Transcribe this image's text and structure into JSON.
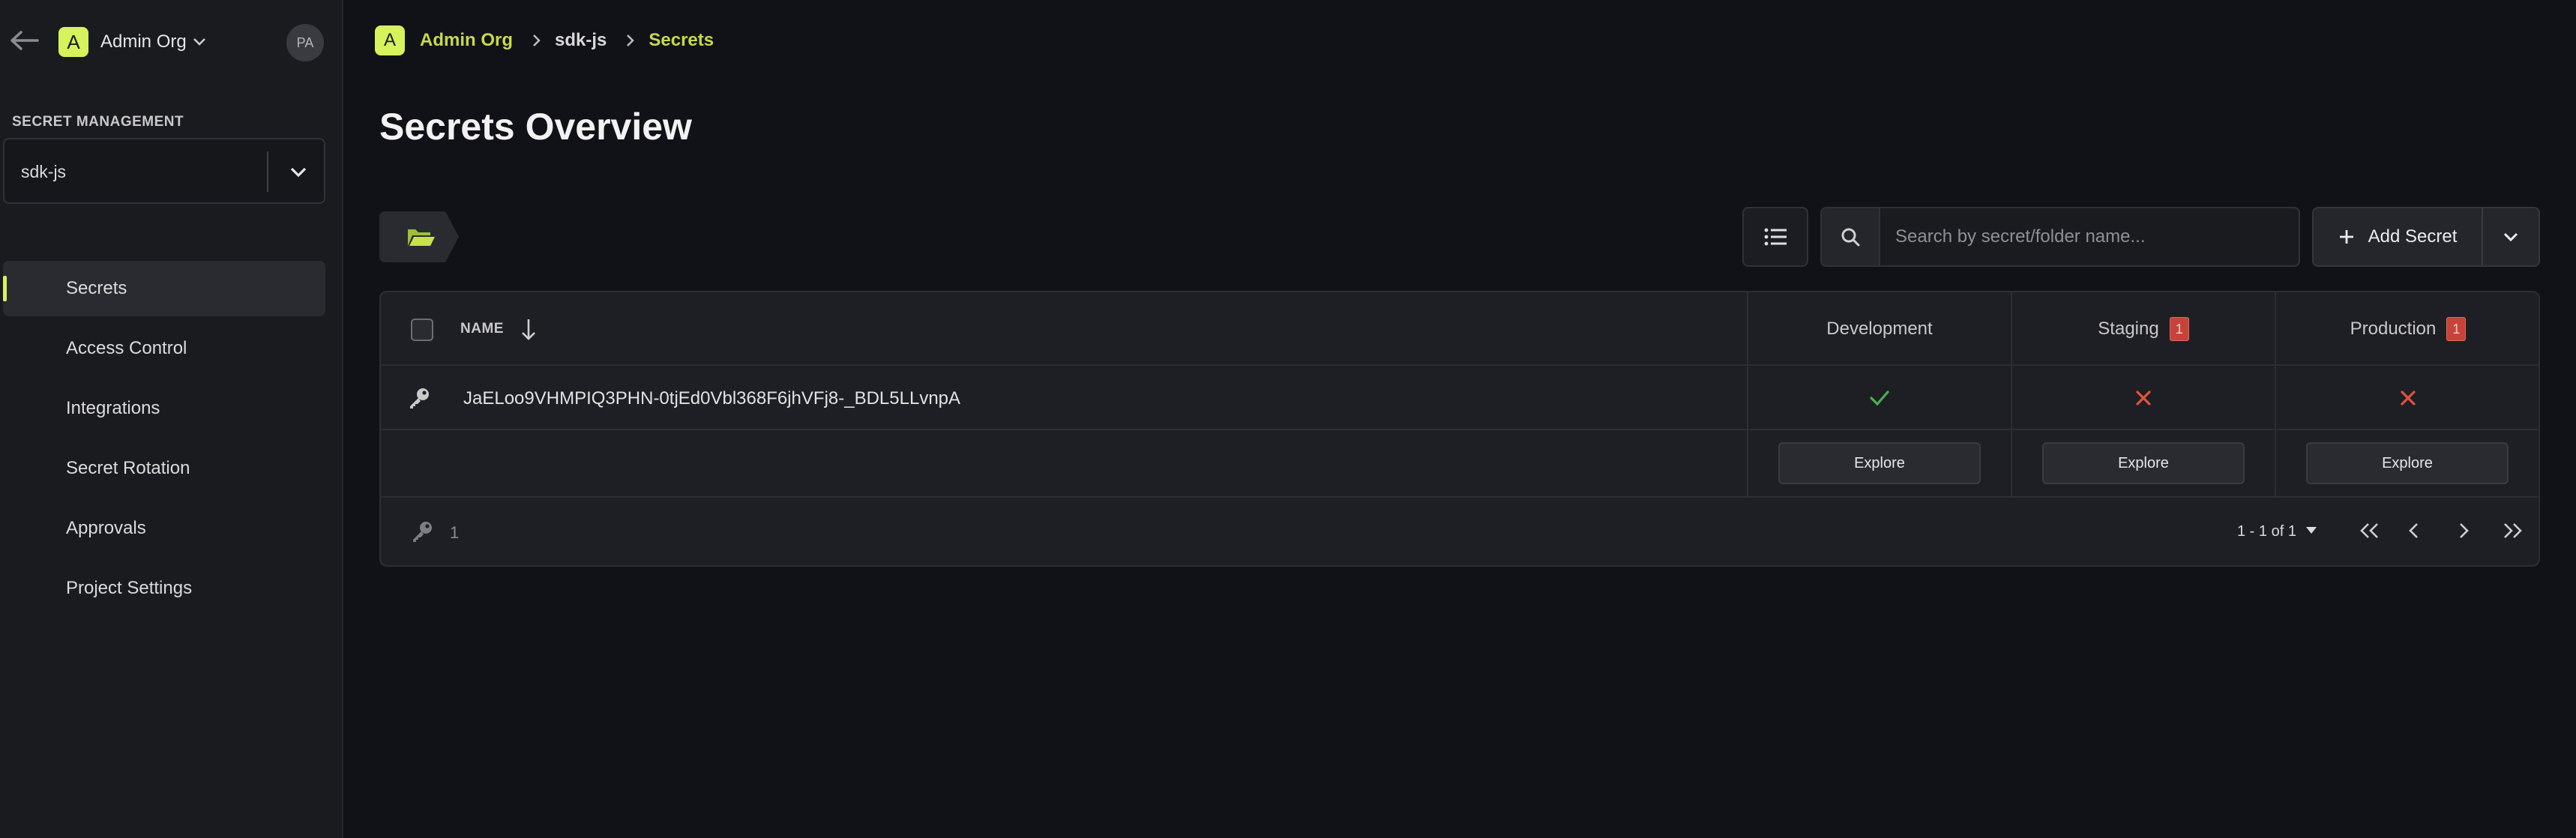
{
  "sidebar": {
    "org_badge": "A",
    "org_name": "Admin Org",
    "avatar_initials": "PA",
    "section_title": "SECRET MANAGEMENT",
    "project_select_value": "sdk-js",
    "nav": [
      {
        "label": "Secrets",
        "active": true
      },
      {
        "label": "Access Control",
        "active": false
      },
      {
        "label": "Integrations",
        "active": false
      },
      {
        "label": "Secret Rotation",
        "active": false
      },
      {
        "label": "Approvals",
        "active": false
      },
      {
        "label": "Project Settings",
        "active": false
      }
    ]
  },
  "breadcrumb": {
    "badge": "A",
    "org": "Admin Org",
    "project": "sdk-js",
    "current": "Secrets"
  },
  "page": {
    "title": "Secrets Overview"
  },
  "toolbar": {
    "search_placeholder": "Search by secret/folder name...",
    "add_secret_label": "Add Secret"
  },
  "table": {
    "name_header": "NAME",
    "environments": [
      {
        "name": "Development",
        "badge": ""
      },
      {
        "name": "Staging",
        "badge": "1"
      },
      {
        "name": "Production",
        "badge": "1"
      }
    ],
    "rows": [
      {
        "name": "JaELoo9VHMPIQ3PHN-0tjEd0Vbl368F6jhVFj8-_BDL5LLvnpA",
        "status": [
          "present",
          "missing",
          "missing"
        ]
      }
    ],
    "explore_label": "Explore",
    "footer_count": "1",
    "pagination_range": "1 - 1 of 1"
  },
  "colors": {
    "accent": "#d6f25c",
    "success": "#4caf50",
    "danger": "#e0533f",
    "badge_red": "#c7433a"
  }
}
